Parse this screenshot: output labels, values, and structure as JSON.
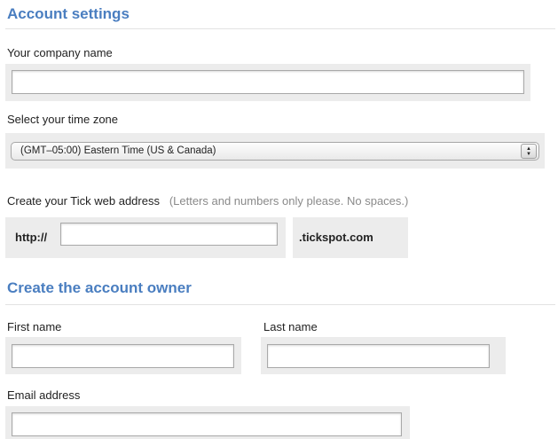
{
  "account_settings": {
    "title": "Account settings",
    "company_name": {
      "label": "Your company name",
      "value": ""
    },
    "time_zone": {
      "label": "Select your time zone",
      "selected": "(GMT–05:00) Eastern Time (US & Canada)"
    },
    "web_address": {
      "label": "Create your Tick web address",
      "hint": "(Letters and numbers only please. No spaces.)",
      "prefix": "http://",
      "value": "",
      "suffix": ".tickspot.com"
    }
  },
  "account_owner": {
    "title": "Create the account owner",
    "first_name": {
      "label": "First name",
      "value": ""
    },
    "last_name": {
      "label": "Last name",
      "value": ""
    },
    "email": {
      "label": "Email address",
      "value": ""
    }
  }
}
